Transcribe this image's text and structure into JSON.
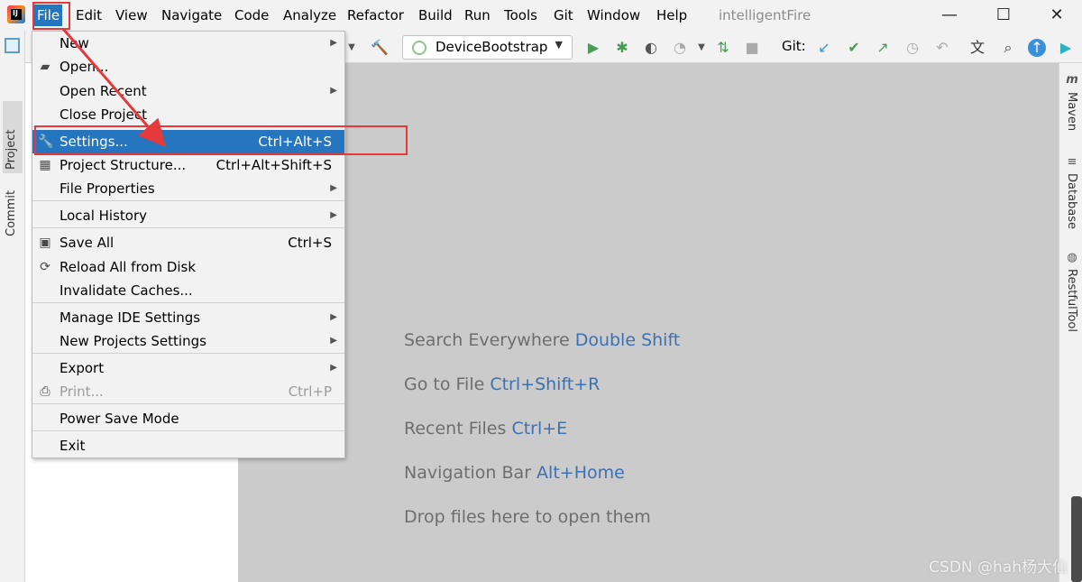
{
  "menubar": {
    "items": [
      "File",
      "Edit",
      "View",
      "Navigate",
      "Code",
      "Analyze",
      "Refactor",
      "Build",
      "Run",
      "Tools",
      "Git",
      "Window",
      "Help"
    ],
    "window_title": "intelligentFire",
    "minimize": "—",
    "maximize": "☐",
    "close": "✕"
  },
  "toolbar": {
    "run_config": "DeviceBootstrap",
    "git_label": "Git:"
  },
  "left_strip": {
    "project_tab": "Project",
    "commit_tab": "Commit"
  },
  "file_menu": {
    "items": [
      {
        "label": "New",
        "accel": "",
        "submenu": true,
        "icon": ""
      },
      {
        "label": "Open...",
        "accel": "",
        "submenu": false,
        "icon": "folder-icon"
      },
      {
        "label": "Open Recent",
        "accel": "",
        "submenu": true,
        "icon": ""
      },
      {
        "label": "Close Project",
        "accel": "",
        "submenu": false,
        "icon": ""
      },
      {
        "label": "Settings...",
        "accel": "Ctrl+Alt+S",
        "submenu": false,
        "icon": "wrench-icon",
        "selected": true
      },
      {
        "label": "Project Structure...",
        "accel": "Ctrl+Alt+Shift+S",
        "submenu": false,
        "icon": "project-structure-icon"
      },
      {
        "label": "File Properties",
        "accel": "",
        "submenu": true,
        "icon": ""
      },
      {
        "label": "Local History",
        "accel": "",
        "submenu": true,
        "icon": ""
      },
      {
        "label": "Save All",
        "accel": "Ctrl+S",
        "submenu": false,
        "icon": "save-icon"
      },
      {
        "label": "Reload All from Disk",
        "accel": "",
        "submenu": false,
        "icon": "reload-icon"
      },
      {
        "label": "Invalidate Caches...",
        "accel": "",
        "submenu": false,
        "icon": ""
      },
      {
        "label": "Manage IDE Settings",
        "accel": "",
        "submenu": true,
        "icon": ""
      },
      {
        "label": "New Projects Settings",
        "accel": "",
        "submenu": true,
        "icon": ""
      },
      {
        "label": "Export",
        "accel": "",
        "submenu": true,
        "icon": ""
      },
      {
        "label": "Print...",
        "accel": "Ctrl+P",
        "submenu": false,
        "icon": "print-icon",
        "disabled": true
      },
      {
        "label": "Power Save Mode",
        "accel": "",
        "submenu": false,
        "icon": ""
      },
      {
        "label": "Exit",
        "accel": "",
        "submenu": false,
        "icon": ""
      }
    ]
  },
  "editor_hints": [
    {
      "text": "Search Everywhere ",
      "shortcut": "Double Shift"
    },
    {
      "text": "Go to File ",
      "shortcut": "Ctrl+Shift+R"
    },
    {
      "text": "Recent Files ",
      "shortcut": "Ctrl+E"
    },
    {
      "text": "Navigation Bar ",
      "shortcut": "Alt+Home"
    },
    {
      "text": "Drop files here to open them",
      "shortcut": ""
    }
  ],
  "right_strip": {
    "tabs": [
      "Maven",
      "Database",
      "RestfulTool"
    ]
  },
  "watermark": "CSDN @hah杨大仙",
  "colors": {
    "selection": "#2675bf",
    "annotation": "#e5393c",
    "shortcut_text": "#3c71b3"
  }
}
